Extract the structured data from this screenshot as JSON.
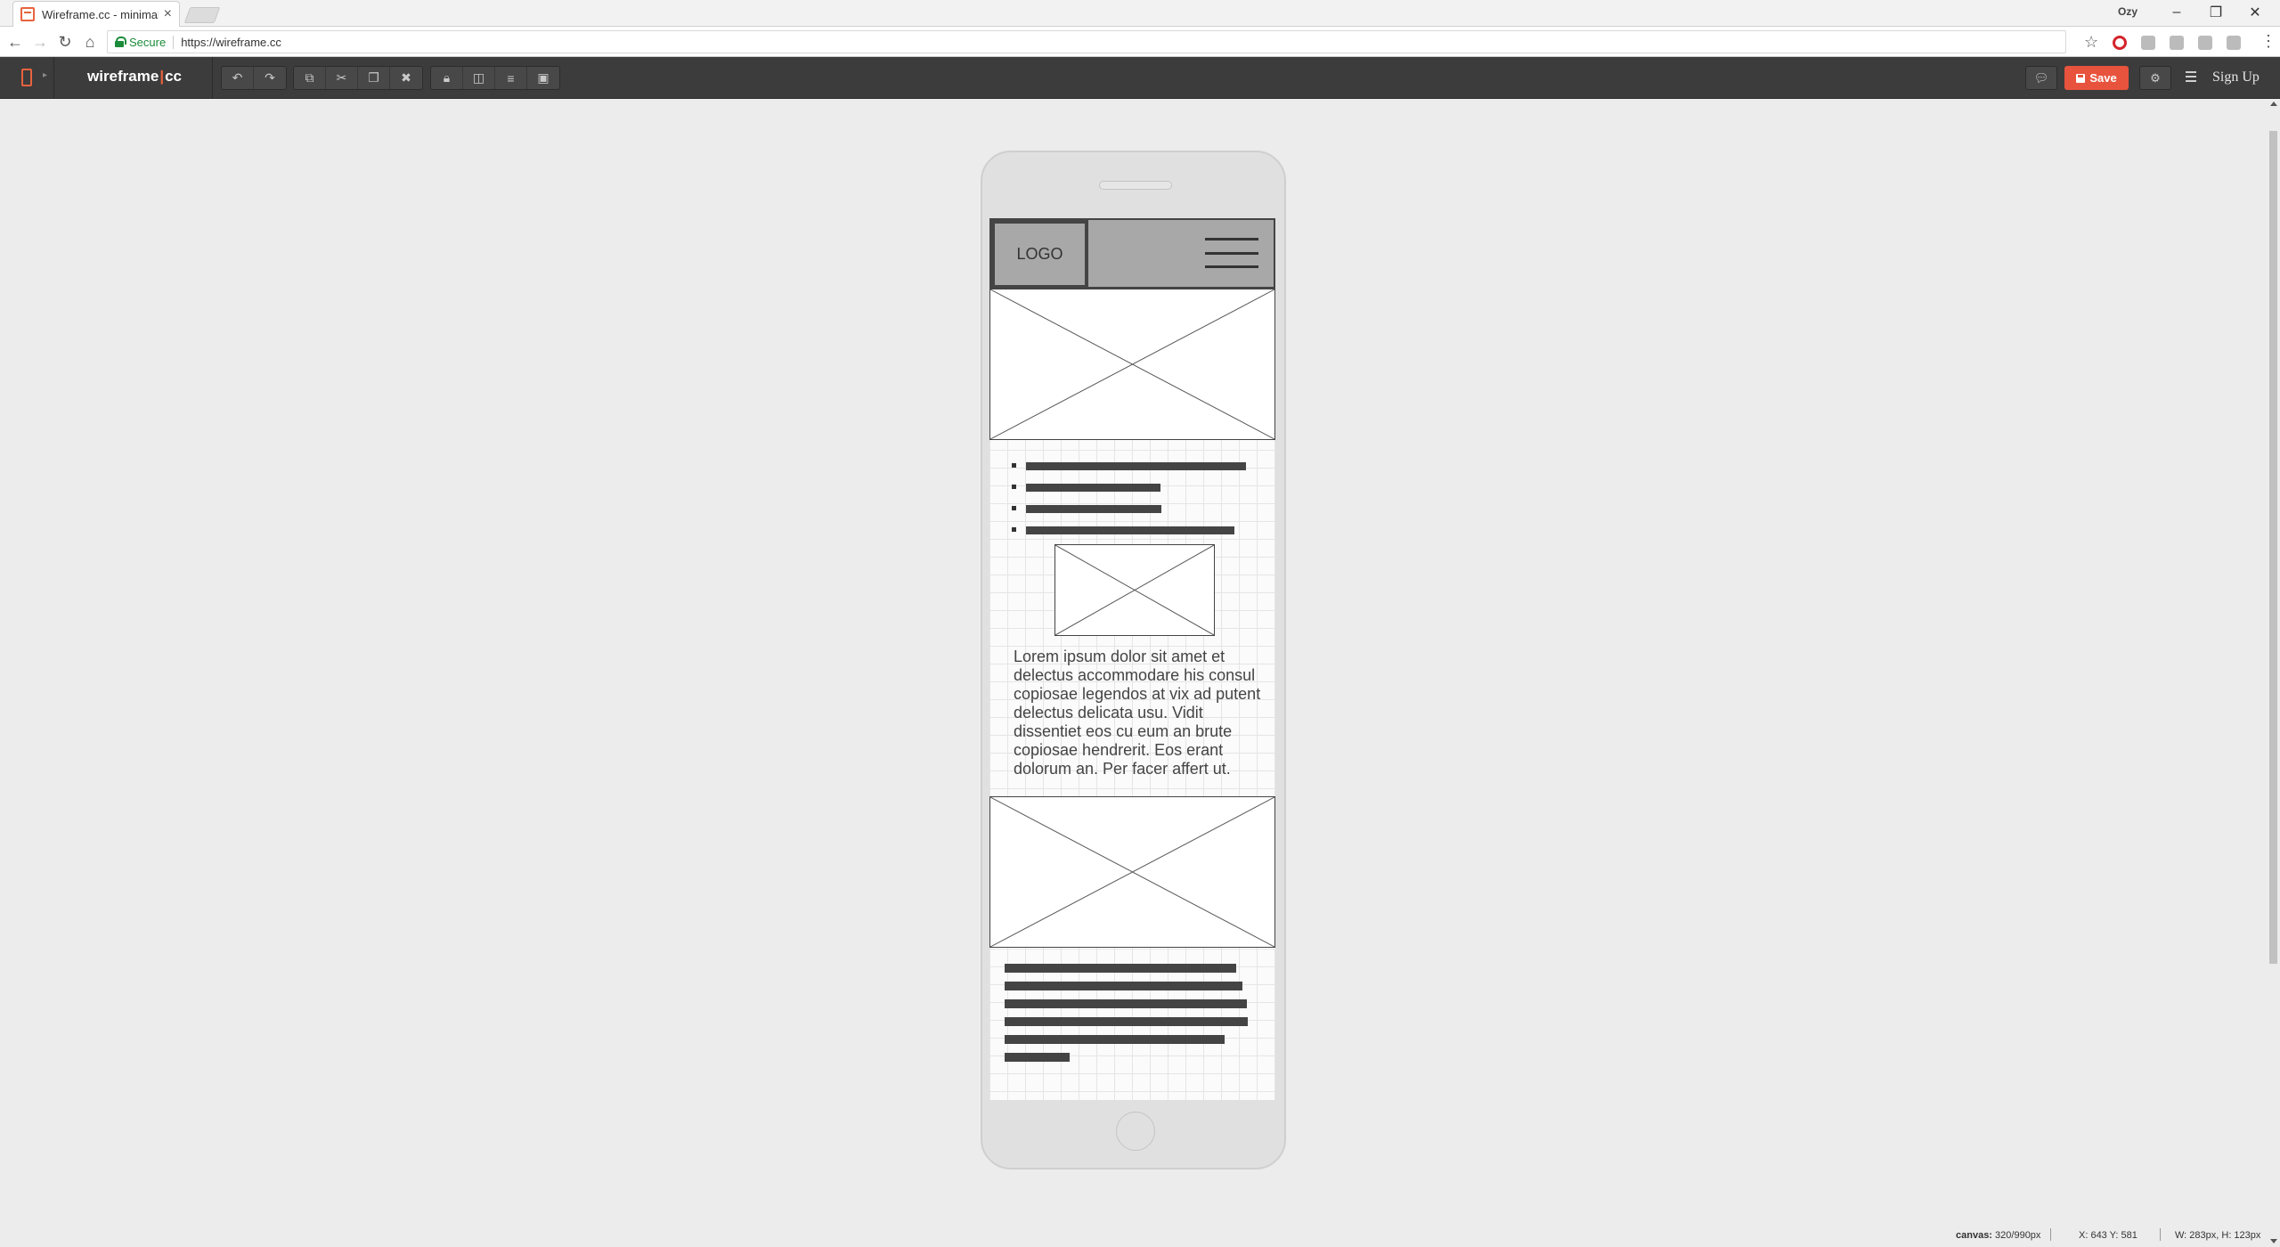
{
  "browser": {
    "tab_title": "Wireframe.cc - minimal w",
    "tab_close": "×",
    "profile": "Ozy",
    "window_controls": [
      "–",
      "❐",
      "✕"
    ],
    "secure_label": "Secure",
    "url": "https://wireframe.cc"
  },
  "toolbar": {
    "brand_left": "wireframe",
    "brand_sep": "|",
    "brand_right": "cc",
    "save_label": "Save",
    "signup_label": "Sign Up",
    "icons": {
      "history": [
        "undo-icon",
        "redo-icon"
      ],
      "edit": [
        "copy-icon",
        "cut-icon",
        "paste-icon",
        "delete-icon"
      ],
      "arrange": [
        "lock-icon",
        "send-to-back-icon",
        "align-icon",
        "group-icon"
      ]
    },
    "accent_color": "#e8533d"
  },
  "wireframe": {
    "logo_label": "LOGO",
    "bullet_items": 4,
    "paragraph": "Lorem ipsum dolor sit amet et delectus accommodare his consul copiosae legendos at vix ad putent delectus delicata usu. Vidit dissentiet eos cu eum an brute copiosae hendrerit. Eos erant dolorum an. Per facer affert ut.",
    "text_lines": 6
  },
  "status": {
    "canvas_label": "canvas:",
    "canvas_value": "320/990px",
    "coords_label": "X: 643 Y: 581",
    "size_label": "W: 283px, H: 123px"
  }
}
